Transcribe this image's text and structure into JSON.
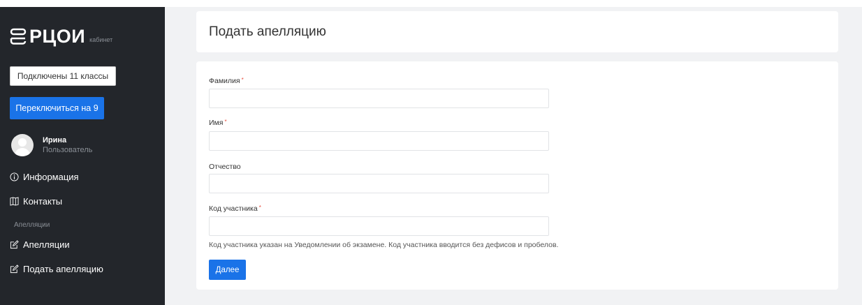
{
  "brand": {
    "name": "РЦОИ",
    "subtitle": "кабинет"
  },
  "sidebar": {
    "connected_label": "Подключены 11 классы",
    "switch_label": "Переключиться на 9",
    "user": {
      "name": "Ирина",
      "role": "Пользователь"
    },
    "items": [
      {
        "label": "Информация",
        "icon": "info-circle-icon"
      },
      {
        "label": "Контакты",
        "icon": "map-icon"
      }
    ],
    "section_label": "Апелляции",
    "section_items": [
      {
        "label": "Апелляции",
        "icon": "edit-icon"
      },
      {
        "label": "Подать апелляцию",
        "icon": "edit-icon"
      }
    ]
  },
  "page": {
    "title": "Подать апелляцию"
  },
  "form": {
    "fields": [
      {
        "label": "Фамилия",
        "required": true,
        "value": ""
      },
      {
        "label": "Имя",
        "required": true,
        "value": ""
      },
      {
        "label": "Отчество",
        "required": false,
        "value": ""
      },
      {
        "label": "Код участника",
        "required": true,
        "value": ""
      }
    ],
    "required_mark": "*",
    "hint": "Код участника указан на Уведомлении об экзамене. Код участника вводится без дефисов и пробелов.",
    "submit_label": "Далее"
  },
  "colors": {
    "sidebar_bg": "#23262b",
    "accent": "#1a73e8",
    "content_bg": "#f1f2f4",
    "required": "#e74c3c"
  }
}
